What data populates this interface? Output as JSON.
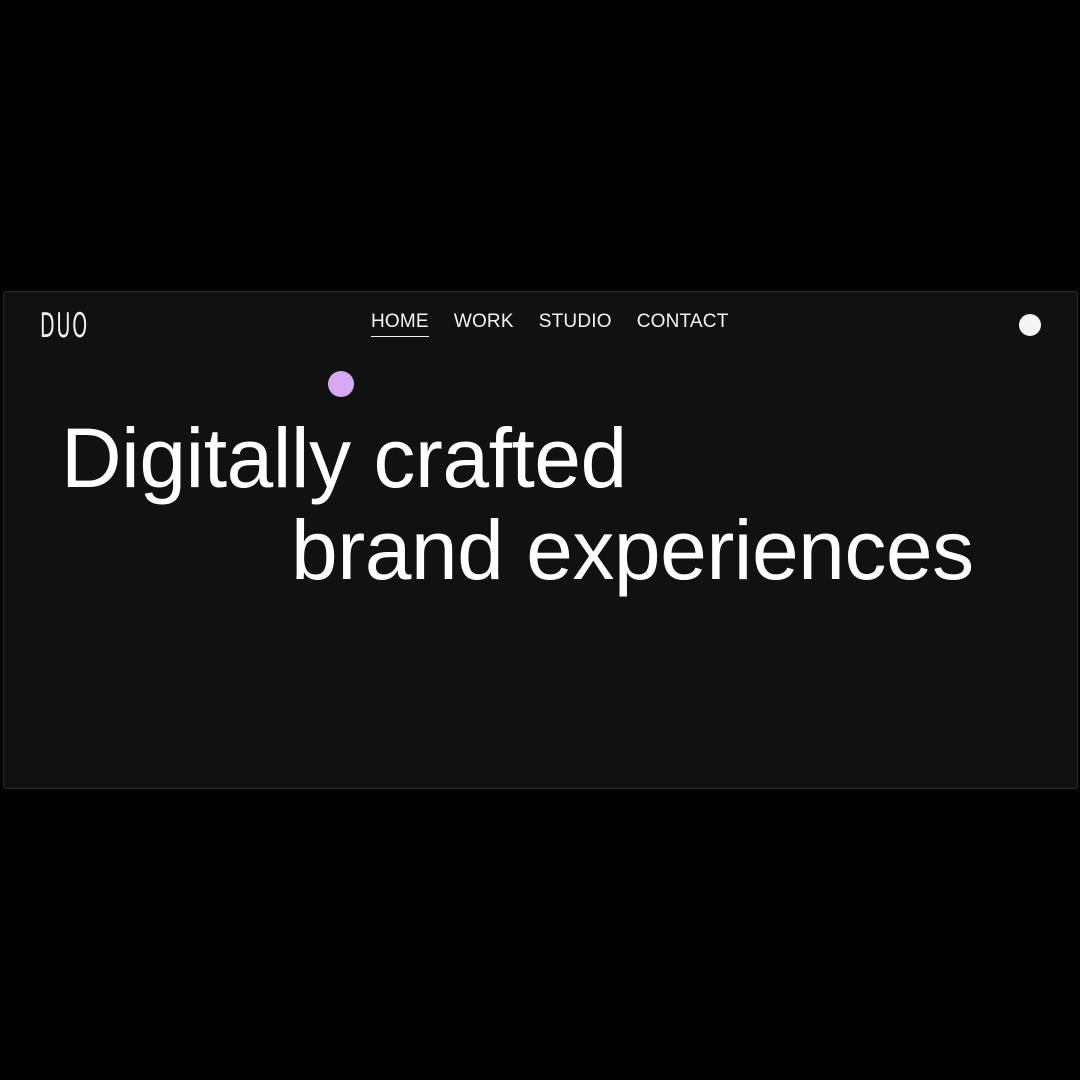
{
  "brand": {
    "logo_text": "DUO"
  },
  "nav": {
    "items": [
      {
        "label": "HOME",
        "active": true
      },
      {
        "label": "WORK",
        "active": false
      },
      {
        "label": "STUDIO",
        "active": false
      },
      {
        "label": "CONTACT",
        "active": false
      }
    ]
  },
  "hero": {
    "headline_line1": "Digitally crafted",
    "headline_line2": "brand experiences"
  },
  "colors": {
    "background": "#111112",
    "text": "#ffffff",
    "accent": "#d7a9f2",
    "toggle": "#f5f5f5"
  },
  "icons": {
    "theme_toggle": "circle-toggle-icon",
    "accent": "accent-dot-icon"
  }
}
